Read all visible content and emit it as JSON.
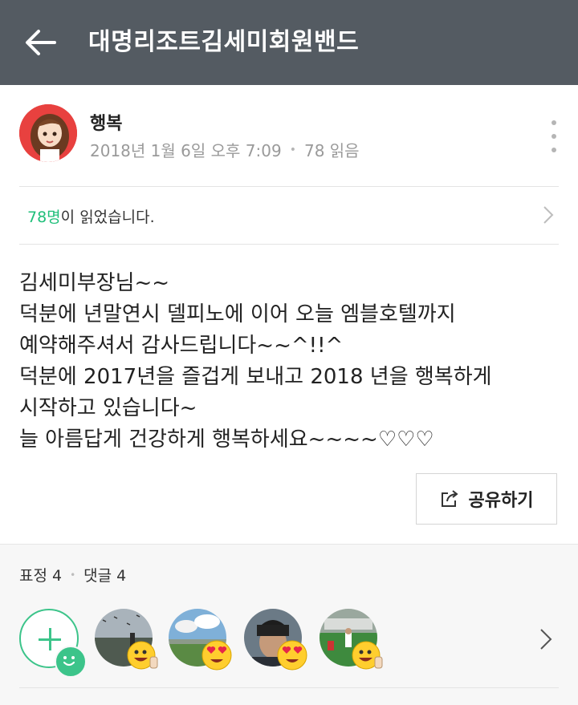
{
  "header": {
    "title": "대명리조트김세미회원밴드",
    "back_icon": "back-arrow-icon"
  },
  "post": {
    "author": "행복",
    "date": "2018년 1월 6일 오후 7:09",
    "read_label": "78 읽음",
    "read_row": {
      "count": "78명",
      "suffix": "이 읽었습니다."
    },
    "body_lines": [
      "김세미부장님~~",
      "덕분에 년말연시 델피노에 이어 오늘 엠블호텔까지",
      "예약해주셔서 감사드립니다~~^!!^",
      "덕분에 2017년을 즐겁게 보내고 2018 년을 행복하게",
      "시작하고 있습니다~",
      "늘 아름답게 건강하게 행복하세요~~~~♡♡♡"
    ],
    "share_label": "공유하기"
  },
  "reactions": {
    "emotion_label": "표정 4",
    "comment_label": "댓글 4",
    "accent_color": "#1fbf7a"
  }
}
